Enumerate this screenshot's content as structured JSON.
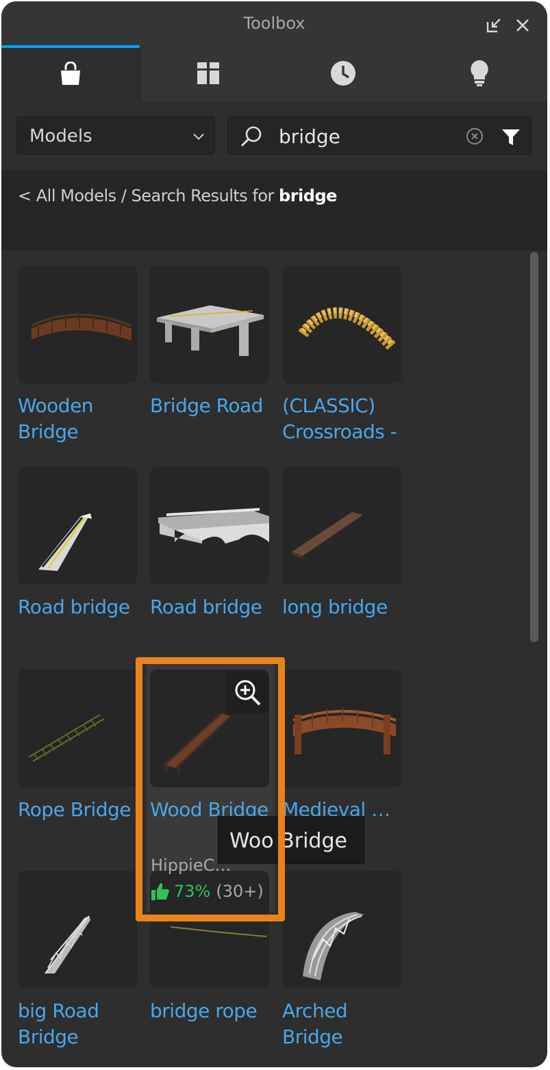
{
  "window": {
    "title": "Toolbox"
  },
  "tabs": [
    {
      "name": "marketplace",
      "icon": "shopping-bag-icon",
      "active": true
    },
    {
      "name": "inventory",
      "icon": "grid-icon",
      "active": false
    },
    {
      "name": "recent",
      "icon": "clock-icon",
      "active": false
    },
    {
      "name": "creations",
      "icon": "lightbulb-icon",
      "active": false
    }
  ],
  "category_dropdown": {
    "selected": "Models"
  },
  "search": {
    "value": "bridge"
  },
  "breadcrumb": {
    "prefix": "< All Models / Search Results for ",
    "term": "bridge"
  },
  "results": [
    {
      "name": "Wooden Bridge"
    },
    {
      "name": "Bridge Road"
    },
    {
      "name": "(CLASSIC) Crossroads -"
    },
    {
      "name": "Road bridge"
    },
    {
      "name": "Road bridge"
    },
    {
      "name": "long bridge"
    },
    {
      "name": "Rope Bridge"
    },
    {
      "name": "Wood Bridge",
      "creator": "HippieC…",
      "rating": "73%",
      "votes": "(30+)"
    },
    {
      "name": "Medieval …"
    },
    {
      "name": "big Road Bridge"
    },
    {
      "name": "bridge rope"
    },
    {
      "name": "Arched Bridge"
    }
  ],
  "tooltip": {
    "text": "Woo Bridge"
  },
  "colors": {
    "accent": "#00a2ff",
    "link": "#4aa6e8",
    "highlight": "#e8841a",
    "rating": "#2fc35a"
  }
}
